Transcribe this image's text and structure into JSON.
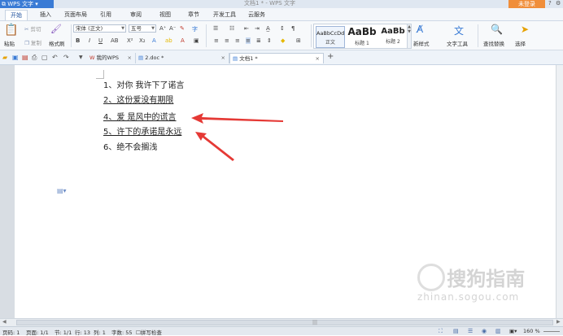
{
  "titlebar": {
    "app_name": "WPS 文字",
    "doc_title": "文档1 * - WPS 文字",
    "login_label": "未登录"
  },
  "ribbon_tabs": [
    "开始",
    "插入",
    "页面布局",
    "引用",
    "审阅",
    "视图",
    "章节",
    "开发工具",
    "云服务"
  ],
  "active_ribbon_tab": "开始",
  "ribbon": {
    "paste_label": "粘贴",
    "cut_label": "剪切",
    "copy_label": "复制",
    "format_painter_label": "格式刷",
    "font_name": "宋体 (正文)",
    "font_size": "五号",
    "styles": [
      {
        "sample": "AaBbCcDd",
        "name": "正文"
      },
      {
        "sample": "AaBb",
        "name": "标题 1"
      },
      {
        "sample": "AaBb",
        "name": "标题 2"
      }
    ],
    "new_style_label": "新样式",
    "text_tools_label": "文字工具",
    "find_replace_label": "查找替换",
    "select_label": "选择"
  },
  "doc_tabs": [
    {
      "label": "我的WPS",
      "active": false
    },
    {
      "label": "2.doc *",
      "active": false
    },
    {
      "label": "文档1 *",
      "active": true
    }
  ],
  "new_tab_label": "+",
  "document": {
    "lines": [
      {
        "text": "1、对你  我许下了诺言",
        "underlined": false
      },
      {
        "text": "2、这份爱没有期限",
        "underlined": true
      },
      {
        "text": "4、爱  是风中的谎言",
        "underlined": true
      },
      {
        "text": "5、许下的承诺是永远",
        "underlined": true
      },
      {
        "text": "6、绝不会搁浅",
        "underlined": false
      }
    ]
  },
  "statusbar": {
    "page_num": "页码: 1",
    "page": "页面: 1/1",
    "section": "节: 1/1",
    "row": "行: 13",
    "col": "列: 1",
    "word_count": "字数: 55",
    "spell_check": "拼写检查",
    "zoom": "160 %"
  },
  "watermark": {
    "brand": "搜狗指南",
    "url": "zhinan.sogou.com"
  },
  "colors": {
    "accent": "#3a7bd5",
    "login": "#f08e3a",
    "arrow": "#e53935"
  }
}
